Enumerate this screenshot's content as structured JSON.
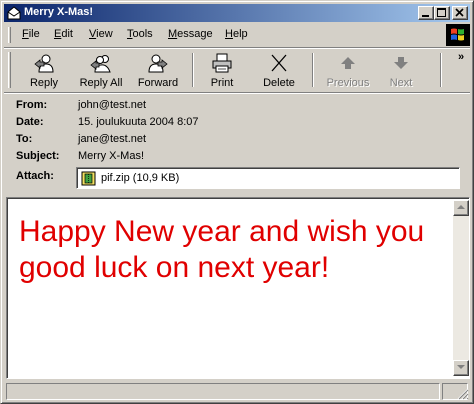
{
  "window": {
    "title": "Merry X-Mas!"
  },
  "menu": [
    {
      "pre": "",
      "acc": "F",
      "post": "ile"
    },
    {
      "pre": "",
      "acc": "E",
      "post": "dit"
    },
    {
      "pre": "",
      "acc": "V",
      "post": "iew"
    },
    {
      "pre": "",
      "acc": "T",
      "post": "ools"
    },
    {
      "pre": "",
      "acc": "M",
      "post": "essage"
    },
    {
      "pre": "",
      "acc": "H",
      "post": "elp"
    }
  ],
  "toolbar": {
    "reply": "Reply",
    "reply_all": "Reply All",
    "forward": "Forward",
    "print": "Print",
    "delete": "Delete",
    "previous": "Previous",
    "next": "Next",
    "chevron": "»"
  },
  "headers": {
    "from_label": "From:",
    "from": "john@test.net",
    "date_label": "Date:",
    "date": "15. joulukuuta 2004 8:07",
    "to_label": "To:",
    "to": "jane@test.net",
    "subject_label": "Subject:",
    "subject": "Merry X-Mas!",
    "attach_label": "Attach:",
    "attachment": "pif.zip (10,9 KB)"
  },
  "message": {
    "body": "Happy New year and wish you good luck on next year!",
    "color": "#e00000"
  },
  "colors": {
    "title_start": "#0a246a",
    "title_end": "#a6caf0",
    "face": "#d4d0c8"
  }
}
